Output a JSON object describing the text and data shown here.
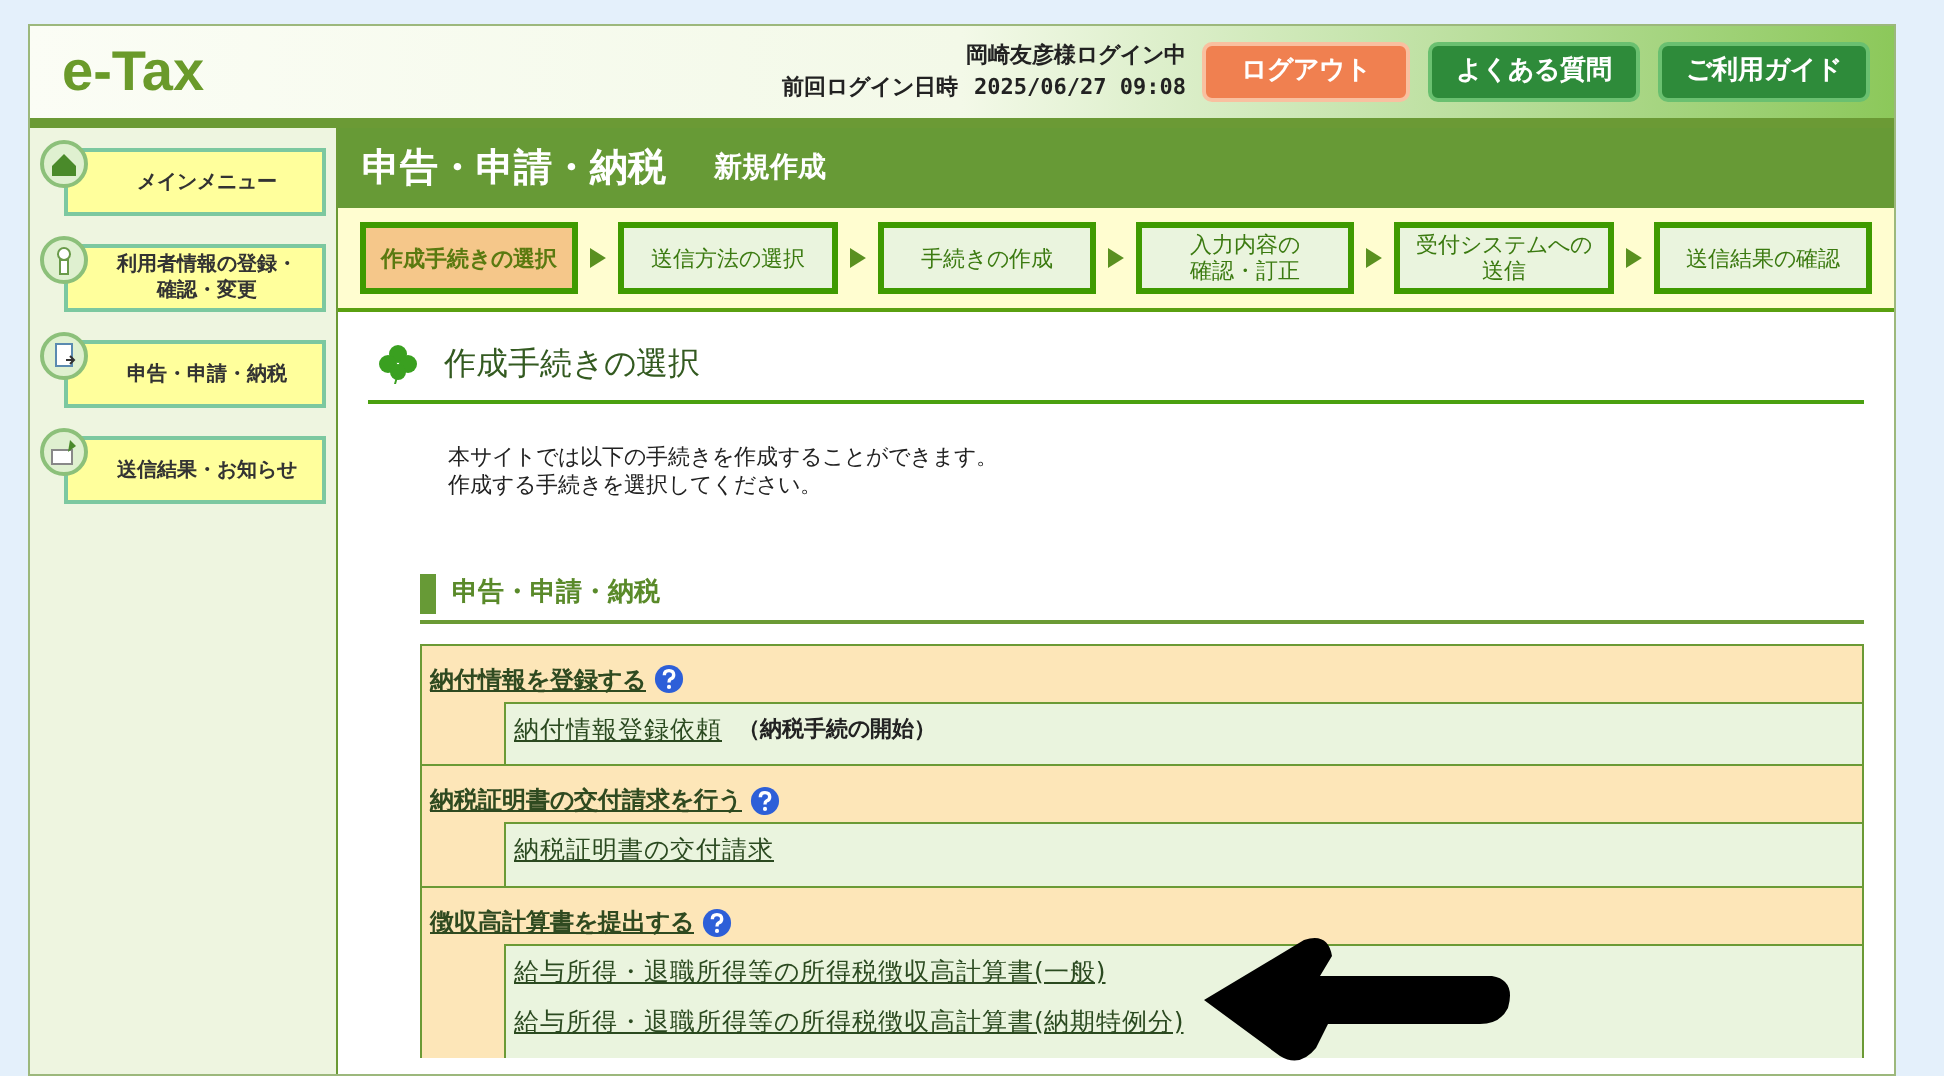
{
  "header": {
    "logo": "e-Tax",
    "user": "岡崎友彦様ログイン中",
    "last_login_label": "前回ログイン日時",
    "last_login": "2025/06/27 09:08",
    "buttons": [
      {
        "label": "ログアウト",
        "kind": "logout"
      },
      {
        "label": "よくある質問",
        "kind": "nav"
      },
      {
        "label": "ご利用ガイド",
        "kind": "nav"
      }
    ]
  },
  "sidebar": {
    "items": [
      {
        "label": "メインメニュー",
        "kind": "home"
      },
      {
        "lines": [
          "利用者情報の登録・",
          "確認・変更"
        ],
        "kind": "user"
      },
      {
        "label": "申告・申請・納税",
        "kind": "file"
      },
      {
        "label": "送信結果・お知らせ",
        "kind": "mail"
      }
    ]
  },
  "title_bar": {
    "title": "申告・申請・納税",
    "subtitle": "新規作成"
  },
  "steps": [
    {
      "label": "作成手続きの選択",
      "selected": true
    },
    {
      "label": "送信方法の選択",
      "selected": false
    },
    {
      "label": "手続きの作成",
      "selected": false
    },
    {
      "lines": [
        "入力内容の",
        "確認・訂正"
      ],
      "selected": false
    },
    {
      "lines": [
        "受付システムへの",
        "送信"
      ],
      "selected": false
    },
    {
      "label": "送信結果の確認",
      "selected": false
    }
  ],
  "page": {
    "heading": "作成手続きの選択",
    "intro": [
      "本サイトでは以下の手続きを作成することができます。",
      "作成する手続きを選択してください。"
    ],
    "section_title": "申告・申請・納税",
    "groups": [
      {
        "title": "納付情報を登録する",
        "items": [
          {
            "label": "納付情報登録依頼",
            "note": "（納税手続の開始）"
          }
        ]
      },
      {
        "title": "納税証明書の交付請求を行う",
        "items": [
          {
            "label": "納税証明書の交付請求"
          }
        ]
      },
      {
        "title": "徴収高計算書を提出する",
        "items": [
          {
            "label": "給与所得・退職所得等の所得税徴収高計算書(一般)"
          },
          {
            "label": "給与所得・退職所得等の所得税徴収高計算書(納期特例分)"
          }
        ]
      }
    ]
  }
}
